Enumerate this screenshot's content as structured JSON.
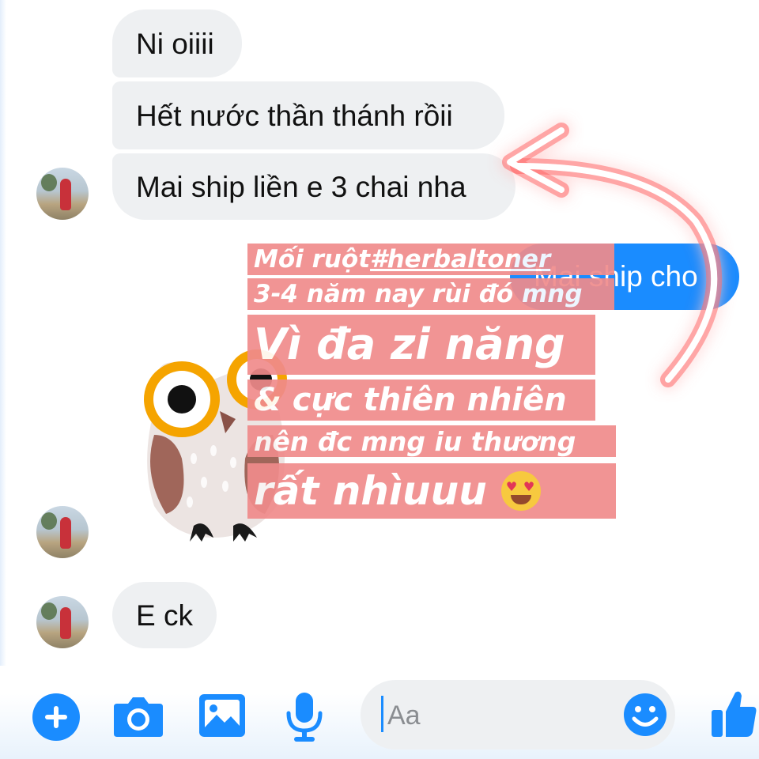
{
  "messages": [
    {
      "text": "Ni oiiii"
    },
    {
      "text": "Hết nước thần thánh rồii"
    },
    {
      "text": "Mai ship liền e 3 chai nha"
    },
    {
      "text": "E ck"
    }
  ],
  "sent_partial": "Mai ship cho",
  "caption": {
    "line1_prefix": "Mối ruột ",
    "line1_tag": "#herbaltoner",
    "line2": "3-4 năm nay rùi đó mng",
    "line3": "Vì đa zi năng",
    "line4": "& cực thiên nhiên",
    "line5": "nên đc mng iu thương",
    "line6": "rất nhìuuu"
  },
  "composer": {
    "placeholder": "Aa"
  },
  "colors": {
    "accent": "#1a8cff",
    "bubble": "#eef0f2",
    "caption_bg": "#f08b8b",
    "owl_eye": "#f5a400"
  },
  "icons": [
    "plus-icon",
    "camera-icon",
    "image-icon",
    "microphone-icon",
    "emoji-icon",
    "thumbs-up-icon",
    "heart-eyes-emoji",
    "owl-sticker"
  ]
}
